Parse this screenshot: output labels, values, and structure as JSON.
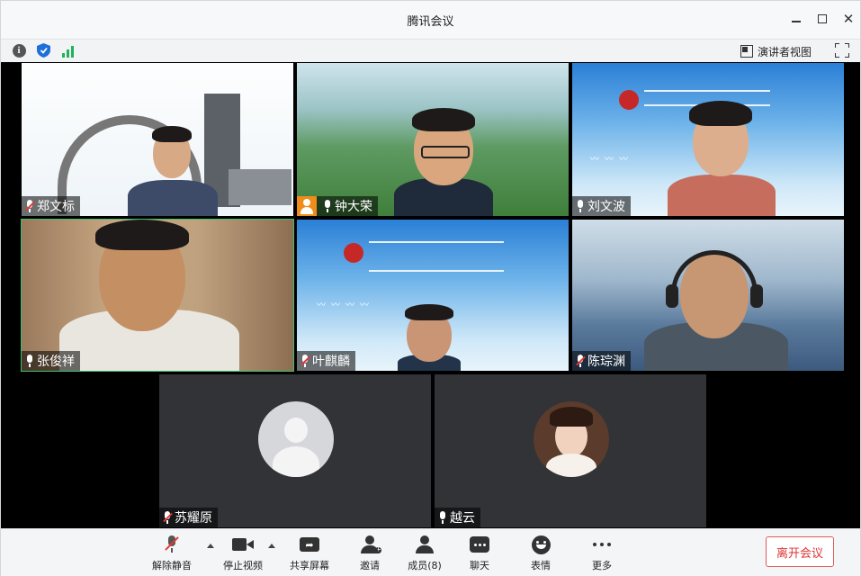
{
  "window": {
    "title": "腾讯会议"
  },
  "topbar": {
    "speaker_view_label": "演讲者视图"
  },
  "participants": [
    {
      "name": "郑文标",
      "muted": true
    },
    {
      "name": "钟大荣",
      "muted": false,
      "host": true
    },
    {
      "name": "刘文波",
      "muted": false
    },
    {
      "name": "张俊祥",
      "muted": false,
      "speaking": true
    },
    {
      "name": "叶麒麟",
      "muted": true
    },
    {
      "name": "陈琮渊",
      "muted": true
    },
    {
      "name": "苏耀原",
      "muted": true,
      "video": false
    },
    {
      "name": "越云",
      "muted": false,
      "video": false
    }
  ],
  "toolbar": {
    "unmute_label": "解除静音",
    "stop_video_label": "停止视频",
    "share_label": "共享屏幕",
    "invite_label": "邀请",
    "members_label": "成员(8)",
    "chat_label": "聊天",
    "reactions_label": "表情",
    "more_label": "更多",
    "leave_label": "离开会议",
    "share_glyph": "➦"
  },
  "colors": {
    "speaking_border": "#3fbf6a",
    "leave": "#d33",
    "mute_slash": "#e53935",
    "host_badge": "#f08c1a"
  }
}
